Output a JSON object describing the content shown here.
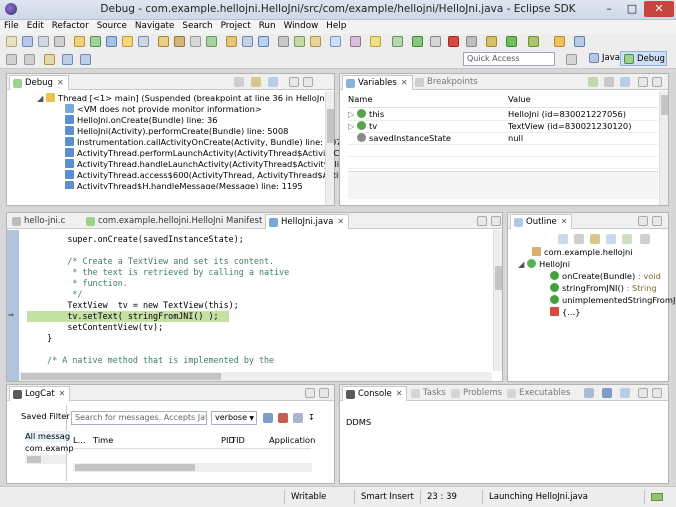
{
  "window": {
    "title": "Debug - com.example.hellojni.HelloJni/src/com/example/hellojni/HelloJni.java - Eclipse SDK"
  },
  "menu": [
    "File",
    "Edit",
    "Refactor",
    "Source",
    "Navigate",
    "Search",
    "Project",
    "Run",
    "Window",
    "Help"
  ],
  "toolbar": {
    "quick_access_placeholder": "Quick Access",
    "perspectives": [
      "Java",
      "Debug"
    ]
  },
  "debug_view": {
    "tab": "Debug",
    "rows": [
      "Thread [<1> main] (Suspended (breakpoint at line 36 in HelloJni))",
      "<VM does not provide monitor information>",
      "HelloJni.onCreate(Bundle) line: 36",
      "HelloJni(Activity).performCreate(Bundle) line: 5008",
      "Instrumentation.callActivityOnCreate(Activity, Bundle) line: 1079",
      "ActivityThread.performLaunchActivity(ActivityThread$ActivityClientR",
      "ActivityThread.handleLaunchActivity(ActivityThread$ActivityClientRe",
      "ActivityThread.access$600(ActivityThread, ActivityThread$ActivityCl",
      "ActivityThread$H.handleMessage(Message) line: 1195"
    ]
  },
  "variables_view": {
    "tabs": [
      "Variables",
      "Breakpoints"
    ],
    "columns": [
      "Name",
      "Value"
    ],
    "rows": [
      {
        "name": "this",
        "value": "HelloJni  (id=830021227056)"
      },
      {
        "name": "tv",
        "value": "TextView  (id=830021230120)"
      },
      {
        "name": "savedInstanceState",
        "value": "null"
      }
    ]
  },
  "editor": {
    "tabs": [
      "hello-jni.c",
      "com.example.hellojni.HelloJni Manifest",
      "HelloJni.java"
    ],
    "lines": [
      "        super.onCreate(savedInstanceState);",
      "",
      "        /* Create a TextView and set its content.",
      "         * the text is retrieved by calling a native",
      "         * function.",
      "         */",
      "        TextView  tv = new TextView(this);",
      "        tv.setText( stringFromJNI() );",
      "        setContentView(tv);",
      "    }",
      "",
      "    /* A native method that is implemented by the"
    ]
  },
  "outline_view": {
    "tab": "Outline",
    "rows": [
      {
        "label": "com.example.hellojni",
        "detail": ""
      },
      {
        "label": "HelloJni",
        "detail": ""
      },
      {
        "label": "onCreate(Bundle)",
        "detail": " : void"
      },
      {
        "label": "stringFromJNI()",
        "detail": " : String"
      },
      {
        "label": "unimplementedStringFromJ",
        "detail": ""
      },
      {
        "label": "{...}",
        "detail": ""
      }
    ]
  },
  "logcat_view": {
    "tab": "LogCat",
    "saved_filters_label": "Saved Filter",
    "saved_filters": [
      "All messag",
      "com.examp"
    ],
    "search_placeholder": "Search for messages. Accepts Java re",
    "level": "verbose",
    "columns": [
      "L...",
      "Time",
      "PID",
      "TID",
      "Application"
    ]
  },
  "console_view": {
    "tabs": [
      "Console",
      "Tasks",
      "Problems",
      "Executables"
    ],
    "content": "DDMS"
  },
  "status_bar": {
    "mode": "Writable",
    "insert": "Smart Insert",
    "position": "23 : 39",
    "task": "Launching HelloJni.java"
  }
}
